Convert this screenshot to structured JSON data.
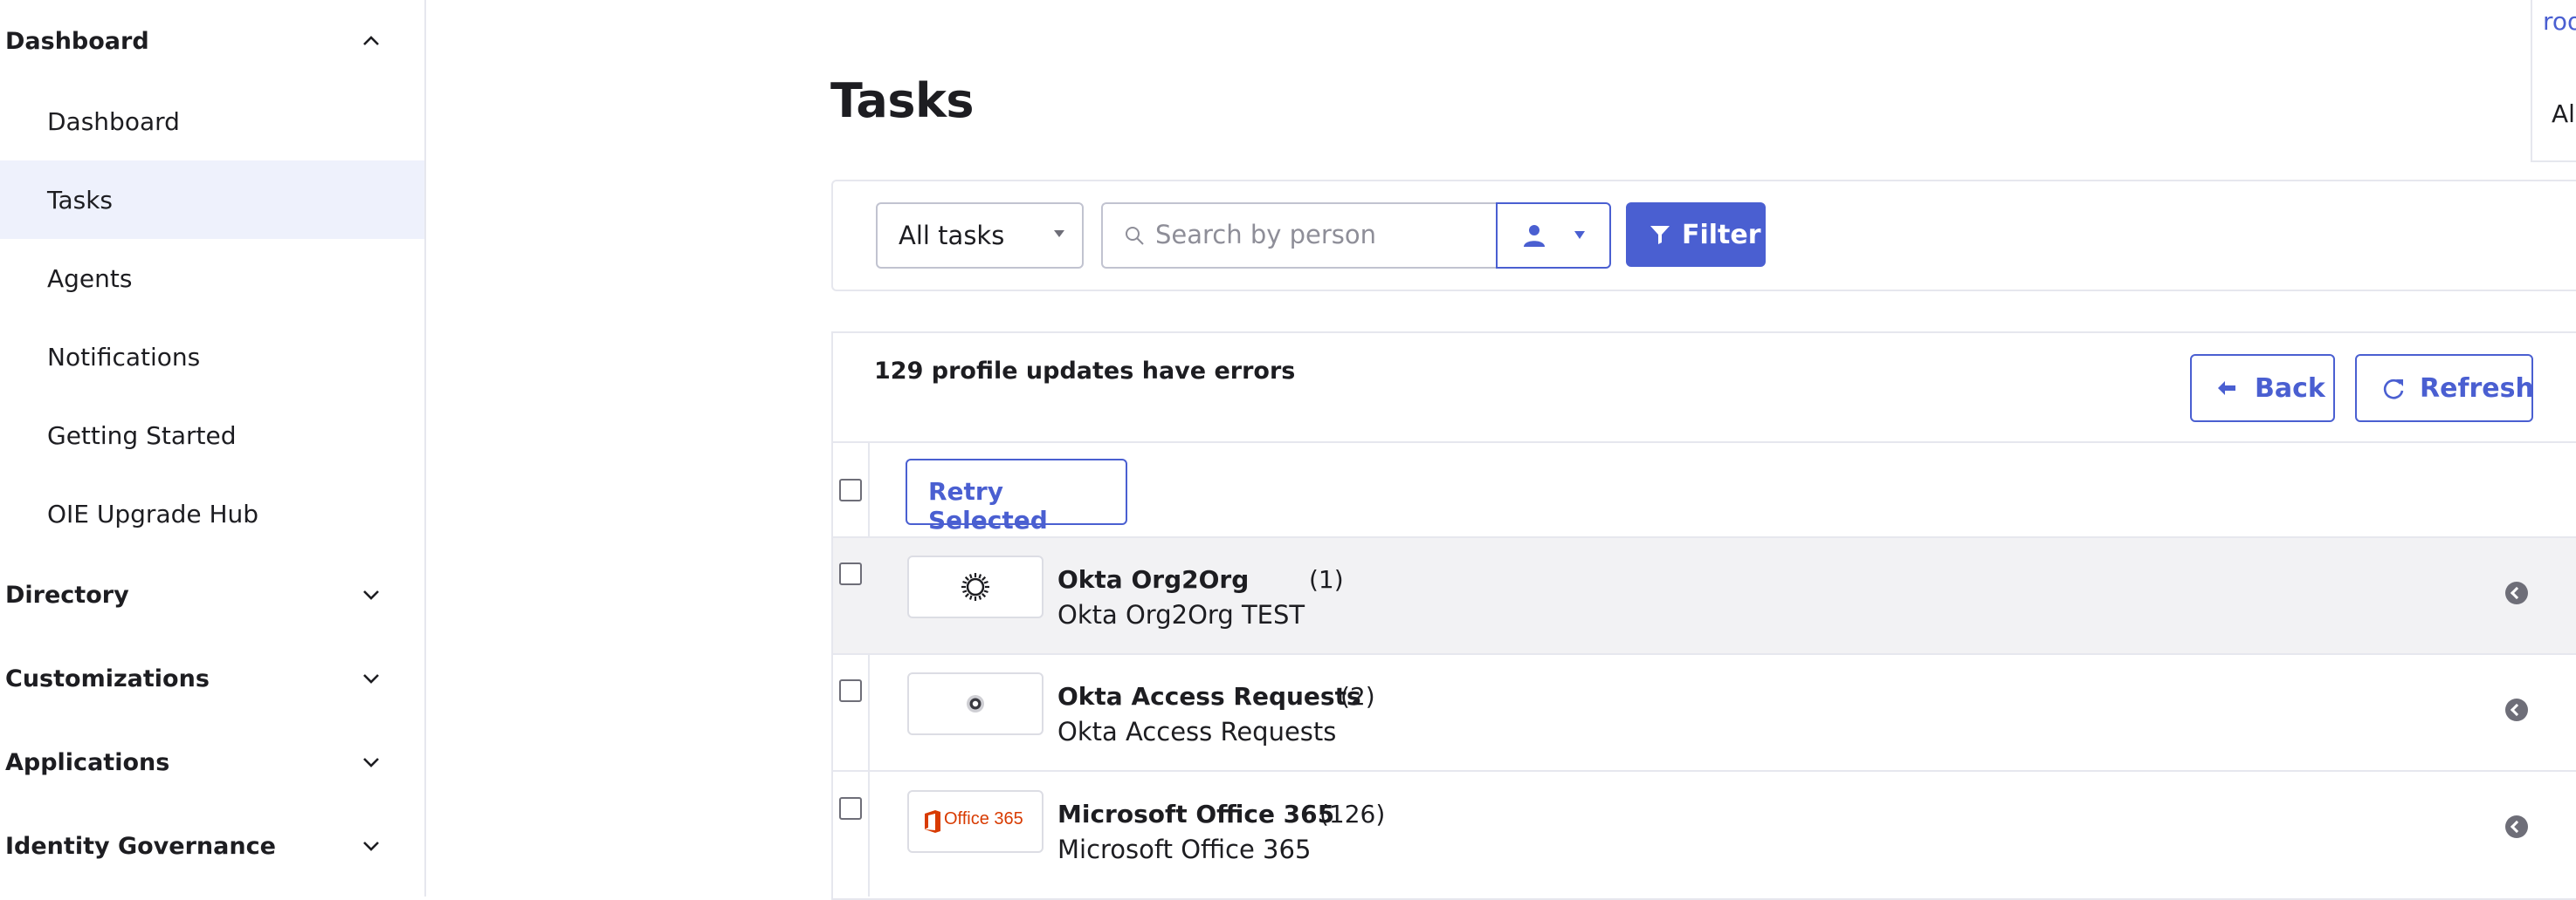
{
  "sidebar": {
    "sections": [
      {
        "label": "Dashboard",
        "expanded": true
      },
      {
        "label": "Directory",
        "expanded": false
      },
      {
        "label": "Customizations",
        "expanded": false
      },
      {
        "label": "Applications",
        "expanded": false
      },
      {
        "label": "Identity Governance",
        "expanded": false
      }
    ],
    "items": [
      {
        "label": "Dashboard"
      },
      {
        "label": "Tasks",
        "active": true
      },
      {
        "label": "Agents"
      },
      {
        "label": "Notifications"
      },
      {
        "label": "Getting Started"
      },
      {
        "label": "OIE Upgrade Hub"
      }
    ]
  },
  "main": {
    "title": "Tasks",
    "filter_bar": {
      "task_select_value": "All tasks",
      "search_placeholder": "Search by person",
      "filter_label": "Filter"
    },
    "results": {
      "error_summary": "129 profile updates have errors",
      "back_label": "Back",
      "refresh_label": "Refresh",
      "retry_selected_label": "Retry Selected"
    },
    "rows": [
      {
        "app_name": "Okta Org2Org",
        "count": "(1)",
        "instance": "Okta Org2Org TEST",
        "logo": "okta-sunburst-icon"
      },
      {
        "app_name": "Okta Access Requests",
        "count": "(2)",
        "instance": "Okta Access Requests",
        "logo": "okta-ring-icon"
      },
      {
        "app_name": "Microsoft Office 365",
        "count": "(126)",
        "instance": "Microsoft Office 365",
        "logo": "office365-logo",
        "logo_text": "Office 365"
      }
    ]
  },
  "right_panel": {
    "link_text": "roo",
    "text": "Al"
  },
  "colors": {
    "accent": "#4a5fd1",
    "active_nav_bg": "#eef1fc",
    "highlight_row_bg": "#f2f2f4",
    "office_red": "#d83b01"
  }
}
